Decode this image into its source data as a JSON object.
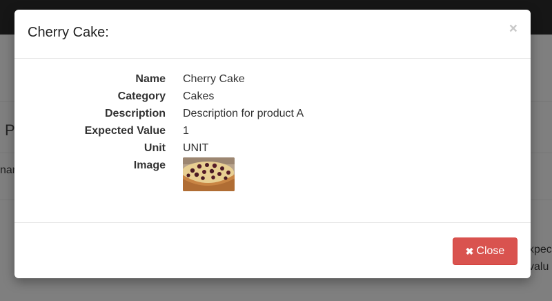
{
  "background": {
    "section_heading": "P",
    "table_cell": "nar",
    "right_text_1": "xpec",
    "right_text_2": "valu"
  },
  "modal": {
    "title": "Cherry Cake:",
    "close_x": "×",
    "fields": [
      {
        "label": "Name",
        "value": "Cherry Cake"
      },
      {
        "label": "Category",
        "value": "Cakes"
      },
      {
        "label": "Description",
        "value": "Description for product A"
      },
      {
        "label": "Expected Value",
        "value": "1"
      },
      {
        "label": "Unit",
        "value": "UNIT"
      },
      {
        "label": "Image",
        "value": ""
      }
    ],
    "close_button": {
      "icon": "times-icon",
      "label": "Close"
    }
  },
  "colors": {
    "danger": "#d9534f",
    "topbar": "#161616",
    "backdrop": "#7f7f7f"
  }
}
